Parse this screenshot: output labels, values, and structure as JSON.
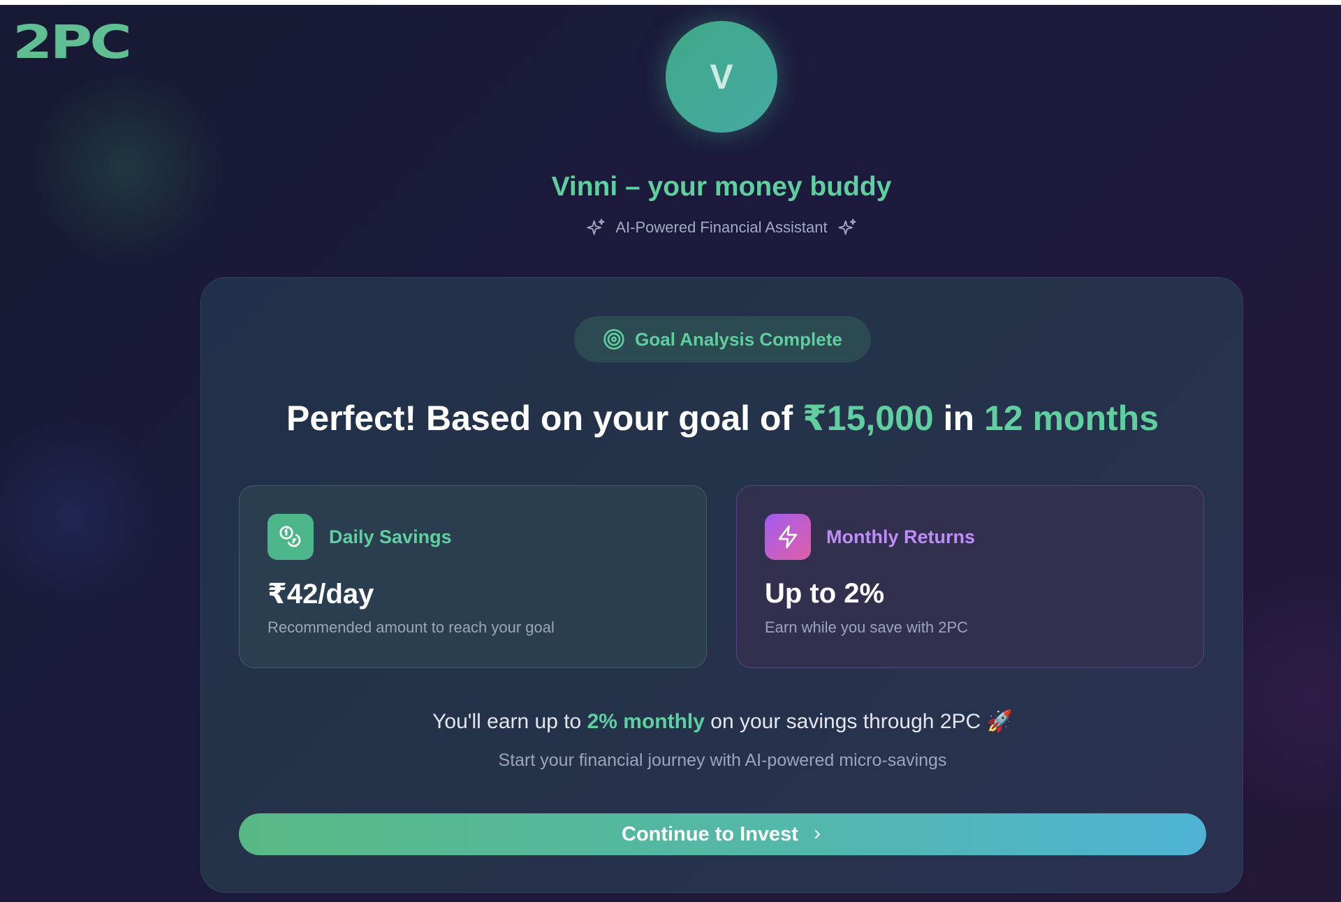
{
  "brand": {
    "logo_text": "2PC",
    "logo_color": "#5fbf93"
  },
  "assistant": {
    "avatar_initial": "V",
    "title": "Vinni – your money buddy",
    "subtitle": "AI-Powered Financial Assistant"
  },
  "card": {
    "badge": {
      "label": "Goal Analysis Complete",
      "icon": "target-icon"
    },
    "headline": {
      "prefix": "Perfect! Based on your goal of ",
      "amount": "₹15,000",
      "middle": " in ",
      "duration": "12 months"
    },
    "daily_savings": {
      "icon": "coins-icon",
      "label": "Daily Savings",
      "value": "₹42/day",
      "description": "Recommended amount to reach your goal"
    },
    "monthly_returns": {
      "icon": "lightning-icon",
      "label": "Monthly Returns",
      "value": "Up to 2%",
      "description": "Earn while you save with 2PC"
    },
    "earn_message": {
      "prefix": "You'll earn up to ",
      "highlight": "2% monthly",
      "suffix": " on your savings through 2PC 🚀"
    },
    "journey_message": "Start your financial journey with AI-powered micro-savings",
    "cta_label": "Continue to Invest"
  },
  "colors": {
    "accent_green": "#5fcf9f",
    "accent_purple": "#c08cf7",
    "background": "#1c1a3c",
    "card": "#243349"
  }
}
